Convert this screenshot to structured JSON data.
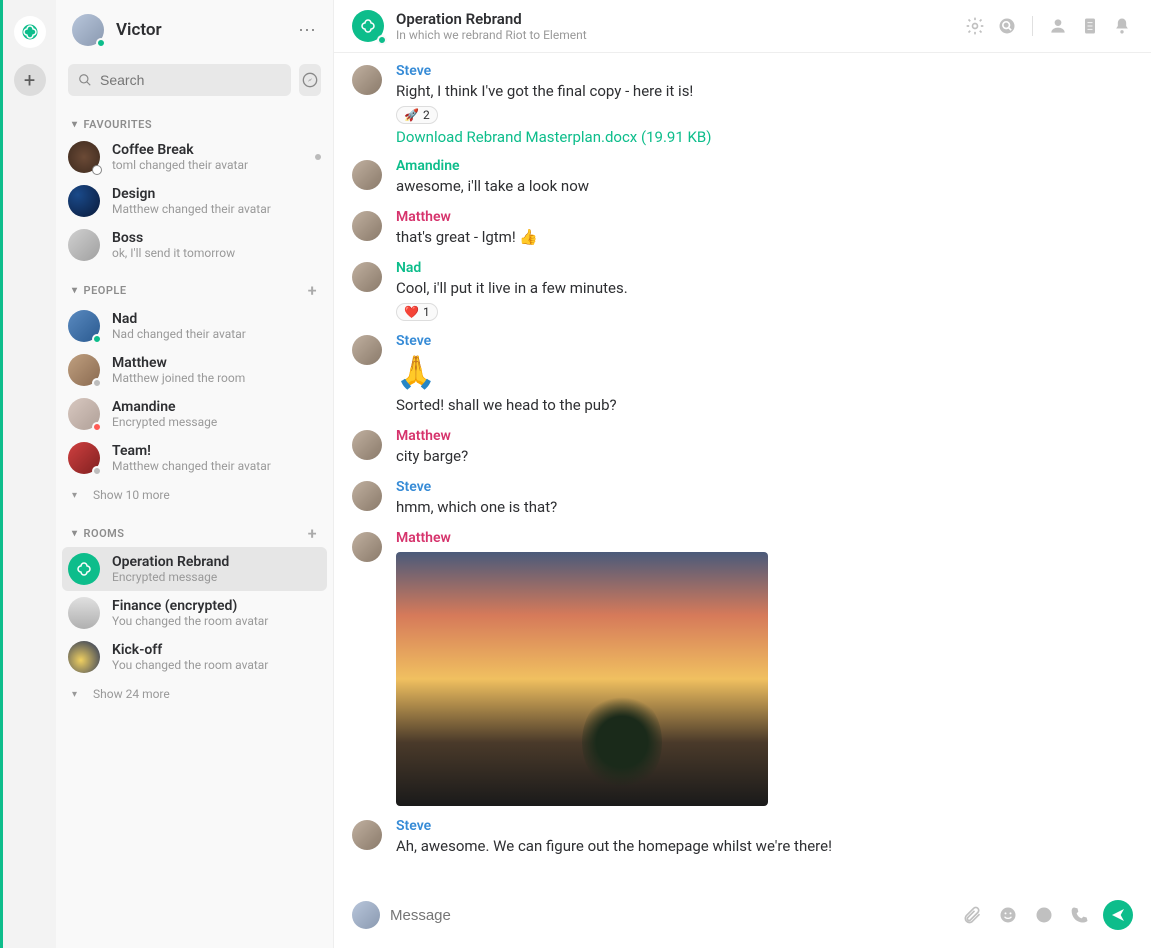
{
  "colors": {
    "accent": "#0dbd8b"
  },
  "user": {
    "name": "Victor"
  },
  "search": {
    "placeholder": "Search"
  },
  "sections": {
    "favourites": {
      "label": "FAVOURITES",
      "items": [
        {
          "name": "Coffee Break",
          "sub": "toml changed their avatar",
          "unread": true
        },
        {
          "name": "Design",
          "sub": "Matthew changed their avatar"
        },
        {
          "name": "Boss",
          "sub": "ok, I'll send it tomorrow"
        }
      ]
    },
    "people": {
      "label": "PEOPLE",
      "items": [
        {
          "name": "Nad",
          "sub": "Nad changed their avatar",
          "presence": "online"
        },
        {
          "name": "Matthew",
          "sub": "Matthew joined the room",
          "presence": "grey"
        },
        {
          "name": "Amandine",
          "sub": "Encrypted message",
          "presence": "red"
        },
        {
          "name": "Team!",
          "sub": "Matthew changed their avatar",
          "presence": "grey"
        }
      ],
      "showMore": "Show 10 more"
    },
    "rooms": {
      "label": "ROOMS",
      "items": [
        {
          "name": "Operation Rebrand",
          "sub": "Encrypted message",
          "selected": true
        },
        {
          "name": "Finance (encrypted)",
          "sub": "You changed the room avatar"
        },
        {
          "name": "Kick-off",
          "sub": "You changed the room avatar"
        }
      ],
      "showMore": "Show 24 more"
    }
  },
  "room": {
    "title": "Operation Rebrand",
    "topic": "In which we rebrand Riot to Element"
  },
  "messages": [
    {
      "sender": "Steve",
      "senderClass": "steve",
      "text": "Right, I think I've got the final copy - here it is!",
      "reaction": {
        "emoji": "🚀",
        "count": 2
      },
      "download": "Download Rebrand Masterplan.docx (19.91 KB)"
    },
    {
      "sender": "Amandine",
      "senderClass": "amandine",
      "text": "awesome, i'll take a look now"
    },
    {
      "sender": "Matthew",
      "senderClass": "matthew",
      "text": "that's great - lgtm! 👍"
    },
    {
      "sender": "Nad",
      "senderClass": "nad",
      "text": "Cool, i'll put it live in a few minutes.",
      "reaction": {
        "emoji": "❤️",
        "count": 1
      }
    },
    {
      "sender": "Steve",
      "senderClass": "steve",
      "bigEmoji": "🙏",
      "text": "Sorted! shall we head to the pub?"
    },
    {
      "sender": "Matthew",
      "senderClass": "matthew",
      "text": "city barge?"
    },
    {
      "sender": "Steve",
      "senderClass": "steve",
      "text": "hmm, which one is that?"
    },
    {
      "sender": "Matthew",
      "senderClass": "matthew",
      "image": true
    },
    {
      "sender": "Steve",
      "senderClass": "steve",
      "text": "Ah, awesome. We can figure out the homepage whilst we're there!"
    }
  ],
  "composer": {
    "placeholder": "Message"
  }
}
